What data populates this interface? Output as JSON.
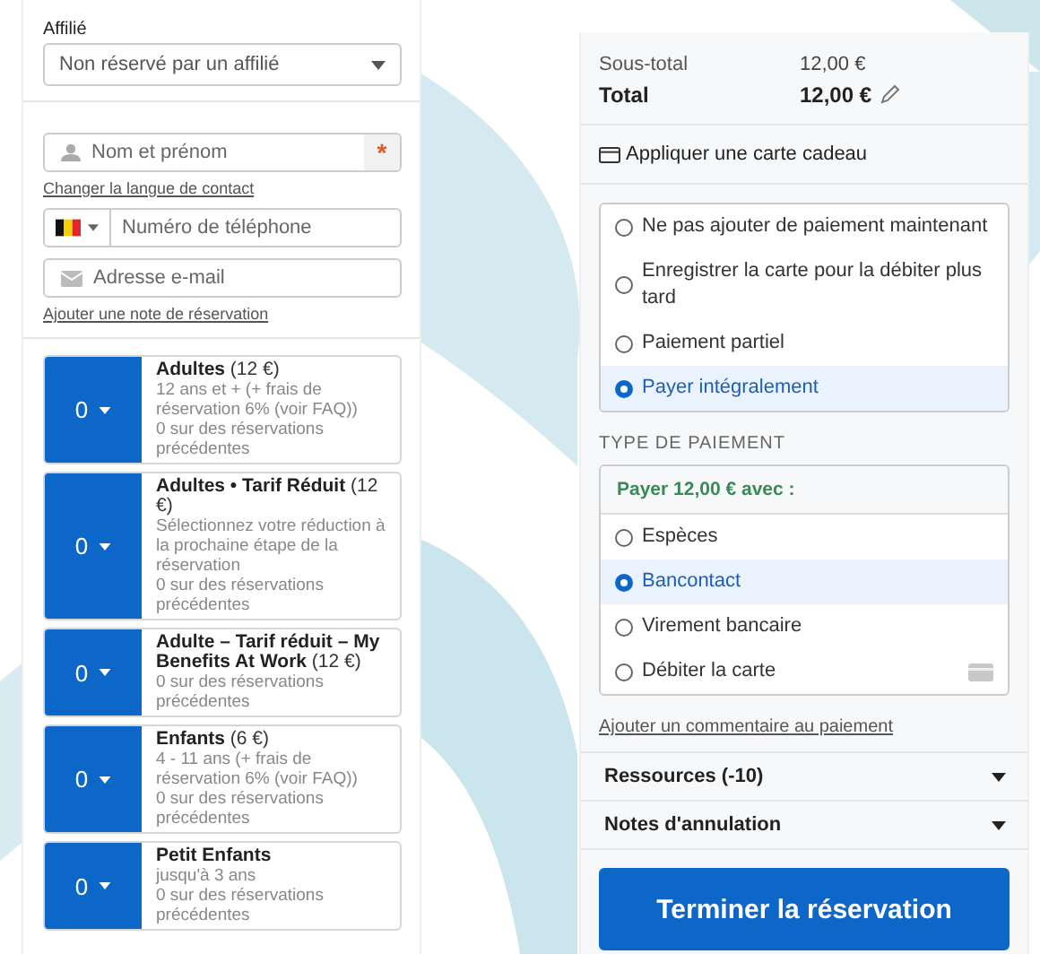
{
  "affiliate": {
    "label": "Affilié",
    "value": "Non réservé par un affilié"
  },
  "contact": {
    "name_placeholder": "Nom et prénom",
    "required_mark": "*",
    "language_link": "Changer la langue de contact",
    "phone_placeholder": "Numéro de téléphone",
    "email_placeholder": "Adresse e-mail",
    "note_link": "Ajouter une note de réservation"
  },
  "tickets": [
    {
      "quantity": "0",
      "title": "**Adultes** (12 €)",
      "lines": [
        "12 ans et + (+ frais de réservation 6% (voir FAQ))",
        "0 sur des réservations précédentes"
      ]
    },
    {
      "quantity": "0",
      "title": "**Adultes • Tarif Réduit** (12 €)",
      "lines": [
        "Sélectionnez votre réduction à la prochaine étape de la réservation",
        "0 sur des réservations précédentes"
      ]
    },
    {
      "quantity": "0",
      "title": "**Adulte – Tarif réduit – My Benefits At Work** (12 €)",
      "lines": [
        "0 sur des réservations précédentes"
      ]
    },
    {
      "quantity": "0",
      "title": "**Enfants** (6 €)",
      "lines": [
        "4 - 11 ans (+ frais de réservation 6% (voir FAQ))",
        "0 sur des réservations précédentes"
      ]
    },
    {
      "quantity": "0",
      "title": "**Petit Enfants**",
      "lines": [
        "jusqu'à 3 ans",
        "0 sur des réservations précédentes"
      ]
    }
  ],
  "summary": [
    {
      "label": "Sous-total",
      "value": "12,00 €",
      "kind": "subtotal"
    },
    {
      "label": "Total",
      "value": "12,00 €",
      "kind": "total"
    }
  ],
  "gift_card": "Appliquer une carte cadeau",
  "payment_options": [
    {
      "label": "Ne pas ajouter de paiement maintenant",
      "selected": false
    },
    {
      "label": "Enregistrer la carte pour la débiter plus tard",
      "selected": false
    },
    {
      "label": "Paiement partiel",
      "selected": false
    },
    {
      "label": "Payer intégralement",
      "selected": true
    }
  ],
  "payment_type": {
    "heading": "TYPE DE PAIEMENT",
    "prompt": "Payer 12,00 € avec :",
    "methods": [
      {
        "label": "Espèces",
        "selected": false,
        "kind": "plain"
      },
      {
        "label": "Bancontact",
        "selected": true,
        "kind": "plain"
      },
      {
        "label": "Virement bancaire",
        "selected": false,
        "kind": "plain"
      },
      {
        "label": "Débiter la carte",
        "selected": false,
        "kind": "card"
      }
    ]
  },
  "comment_link": "Ajouter un commentaire au paiement",
  "sections": [
    {
      "label": "Ressources (-10)",
      "expanded": false
    },
    {
      "label": "Notes d'annulation",
      "expanded": false
    }
  ],
  "submit": "Terminer la réservation"
}
